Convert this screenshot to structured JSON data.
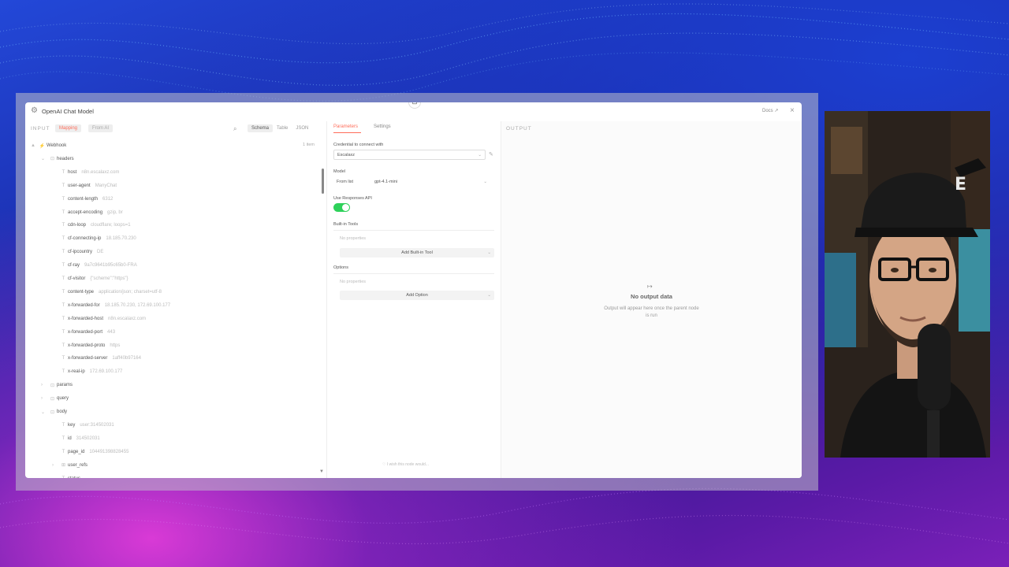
{
  "modal": {
    "title": "OpenAI Chat Model",
    "docs_label": "Docs ↗",
    "close_label": "×"
  },
  "input": {
    "label": "INPUT",
    "mode_tabs": [
      "Mapping",
      "From AI"
    ],
    "view_tabs": [
      "Schema",
      "Table",
      "JSON"
    ],
    "items_count": "1 item",
    "tree": [
      {
        "key": "Webhook",
        "value": "",
        "type": "⚡",
        "indent": 0,
        "twisty": "▲"
      },
      {
        "key": "headers",
        "value": "",
        "type": "⊡",
        "indent": 1,
        "twisty": "⌄"
      },
      {
        "key": "host",
        "value": "n8n.escalaxz.com",
        "type": "T",
        "indent": 2,
        "twisty": ""
      },
      {
        "key": "user-agent",
        "value": "ManyChat",
        "type": "T",
        "indent": 2,
        "twisty": ""
      },
      {
        "key": "content-length",
        "value": "6312",
        "type": "T",
        "indent": 2,
        "twisty": ""
      },
      {
        "key": "accept-encoding",
        "value": "gzip, br",
        "type": "T",
        "indent": 2,
        "twisty": ""
      },
      {
        "key": "cdn-loop",
        "value": "cloudflare; loops=1",
        "type": "T",
        "indent": 2,
        "twisty": ""
      },
      {
        "key": "cf-connecting-ip",
        "value": "18.185.70.230",
        "type": "T",
        "indent": 2,
        "twisty": ""
      },
      {
        "key": "cf-ipcountry",
        "value": "DE",
        "type": "T",
        "indent": 2,
        "twisty": ""
      },
      {
        "key": "cf-ray",
        "value": "9a7c9641b95c65b0-FRA",
        "type": "T",
        "indent": 2,
        "twisty": ""
      },
      {
        "key": "cf-visitor",
        "value": "{\"scheme\":\"https\"}",
        "type": "T",
        "indent": 2,
        "twisty": ""
      },
      {
        "key": "content-type",
        "value": "application/json; charset=utf-8",
        "type": "T",
        "indent": 2,
        "twisty": ""
      },
      {
        "key": "x-forwarded-for",
        "value": "18.185.70.230, 172.69.100.177",
        "type": "T",
        "indent": 2,
        "twisty": ""
      },
      {
        "key": "x-forwarded-host",
        "value": "n8n.escalaxz.com",
        "type": "T",
        "indent": 2,
        "twisty": ""
      },
      {
        "key": "x-forwarded-port",
        "value": "443",
        "type": "T",
        "indent": 2,
        "twisty": ""
      },
      {
        "key": "x-forwarded-proto",
        "value": "https",
        "type": "T",
        "indent": 2,
        "twisty": ""
      },
      {
        "key": "x-forwarded-server",
        "value": "1aff40b97164",
        "type": "T",
        "indent": 2,
        "twisty": ""
      },
      {
        "key": "x-real-ip",
        "value": "172.69.100.177",
        "type": "T",
        "indent": 2,
        "twisty": ""
      },
      {
        "key": "params",
        "value": "",
        "type": "⊡",
        "indent": 1,
        "twisty": "›"
      },
      {
        "key": "query",
        "value": "",
        "type": "⊡",
        "indent": 1,
        "twisty": "›"
      },
      {
        "key": "body",
        "value": "",
        "type": "⊡",
        "indent": 1,
        "twisty": "⌄"
      },
      {
        "key": "key",
        "value": "user:314502031",
        "type": "T",
        "indent": 2,
        "twisty": ""
      },
      {
        "key": "id",
        "value": "314502031",
        "type": "T",
        "indent": 2,
        "twisty": ""
      },
      {
        "key": "page_id",
        "value": "104491398828455",
        "type": "T",
        "indent": 2,
        "twisty": ""
      },
      {
        "key": "user_refs",
        "value": "",
        "type": "⊞",
        "indent": 2,
        "twisty": "›"
      },
      {
        "key": "status",
        "value": "",
        "type": "T",
        "indent": 2,
        "twisty": ""
      }
    ]
  },
  "parameters": {
    "tabs": [
      "Parameters",
      "Settings"
    ],
    "credential_label": "Credential to connect with",
    "credential_value": "Escalaxz",
    "model_label": "Model",
    "model_mode": "From list",
    "model_value": "gpt-4.1-mini",
    "responses_api_label": "Use Responses API",
    "responses_api_enabled": true,
    "builtin_tools_label": "Built-in Tools",
    "builtin_tools_empty": "No properties",
    "add_builtin_tool": "Add Built-in Tool",
    "options_label": "Options",
    "options_empty": "No properties",
    "add_option": "Add Option",
    "feedback": "♡ I wish this node would..."
  },
  "output": {
    "label": "OUTPUT",
    "empty_title": "No output data",
    "empty_desc": "Output will appear here once the parent node is run"
  },
  "colors": {
    "accent": "#ff6d5a",
    "toggle_on": "#2ed15a"
  }
}
